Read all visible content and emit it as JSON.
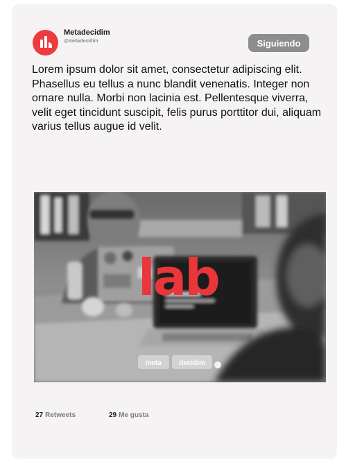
{
  "colors": {
    "card_bg": "#f5f3f4",
    "brand_red": "#ed3b3e",
    "button_gray": "#8d8d8d"
  },
  "tweet": {
    "author_name": "Metadecidim",
    "author_handle": "@metadecidim",
    "avatar_icon": "metadecidim-logo-icon",
    "follow_label": "Siguiendo",
    "text": "Lorem ipsum dolor sit amet, consectetur adipiscing elit. Phasellus eu tellus a nunc blandit venenatis. Integer non ornare nulla. Morbi non lacinia est. Pellentesque viverra, velit eget tincidunt suscipit, felis purus porttitor dui, aliquam varius tellus augue id velit."
  },
  "media": {
    "logo_text": "lab",
    "tag_left": "meta",
    "tag_right": "decidim"
  },
  "stats": {
    "retweets_count": "27",
    "retweets_label": "Retweets",
    "likes_count": "29",
    "likes_label": "Me gusta"
  }
}
